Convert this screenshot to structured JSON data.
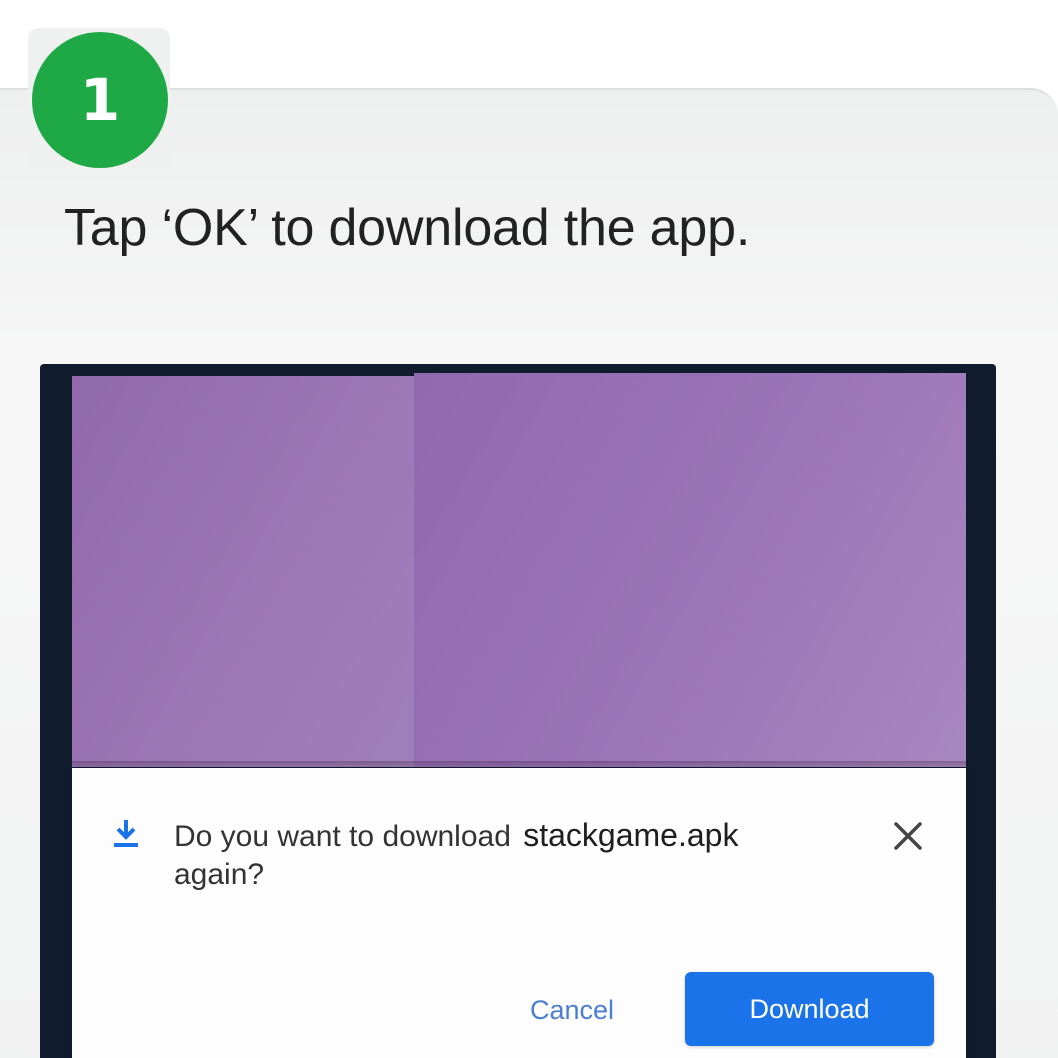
{
  "step": {
    "number": "1",
    "badge_color": "#1fa846"
  },
  "instruction": {
    "text": "Tap ‘OK’ to download the app."
  },
  "dialog": {
    "icon": "download-icon",
    "message_prefix": "Do you want to download",
    "filename": "stackgame.apk",
    "message_suffix": "again?",
    "close_icon": "close-icon",
    "cancel_label": "Cancel",
    "download_label": "Download",
    "accent_color": "#1a73e8"
  },
  "colors": {
    "artwork": "#9a72b6",
    "phone_frame": "#101c2e"
  }
}
